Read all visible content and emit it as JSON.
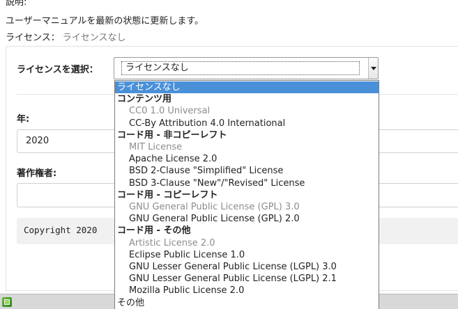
{
  "header": {
    "description_label": "説明:",
    "description_text": "ユーザーマニュアルを最新の状態に更新します。",
    "license_label": "ライセンス：",
    "license_value": "ライセンスなし"
  },
  "form": {
    "select_label": "ライセンスを選択：",
    "select_value": "ライセンスなし",
    "year_label": "年:",
    "year_value": "2020",
    "owner_label": "著作権者:",
    "owner_value": "",
    "preview_text": "Copyright 2020"
  },
  "dropdown": {
    "options": [
      {
        "kind": "selected",
        "label": "ライセンスなし"
      },
      {
        "kind": "group",
        "label": "コンテンツ用"
      },
      {
        "kind": "item-dim",
        "label": "CC0 1.0 Universal"
      },
      {
        "kind": "item",
        "label": "CC-By Attribution 4.0 International"
      },
      {
        "kind": "group",
        "label": "コード用 - 非コピーレフト"
      },
      {
        "kind": "item-dim",
        "label": "MIT License"
      },
      {
        "kind": "item",
        "label": "Apache License 2.0"
      },
      {
        "kind": "item",
        "label": "BSD 2-Clause \"Simplified\" License"
      },
      {
        "kind": "item",
        "label": "BSD 3-Clause \"New\"/\"Revised\" License"
      },
      {
        "kind": "group",
        "label": "コード用 - コピーレフト"
      },
      {
        "kind": "item-dim",
        "label": "GNU General Public License (GPL) 3.0"
      },
      {
        "kind": "item",
        "label": "GNU General Public License (GPL) 2.0"
      },
      {
        "kind": "group",
        "label": "コード用 - その他"
      },
      {
        "kind": "item-dim",
        "label": "Artistic License 2.0"
      },
      {
        "kind": "item",
        "label": "Eclipse Public License 1.0"
      },
      {
        "kind": "item",
        "label": "GNU Lesser General Public License (LGPL) 3.0"
      },
      {
        "kind": "item",
        "label": "GNU Lesser General Public License (LGPL) 2.1"
      },
      {
        "kind": "item",
        "label": "Mozilla Public License 2.0"
      },
      {
        "kind": "plain",
        "label": "その他"
      }
    ]
  },
  "colors": {
    "selected_bg": "#4a90d9",
    "dim_text": "#8c8c8c",
    "preview_bg": "#f1f1f1"
  },
  "icons": {
    "status": "app-status-icon",
    "select_arrow": "chevron-down-icon"
  }
}
